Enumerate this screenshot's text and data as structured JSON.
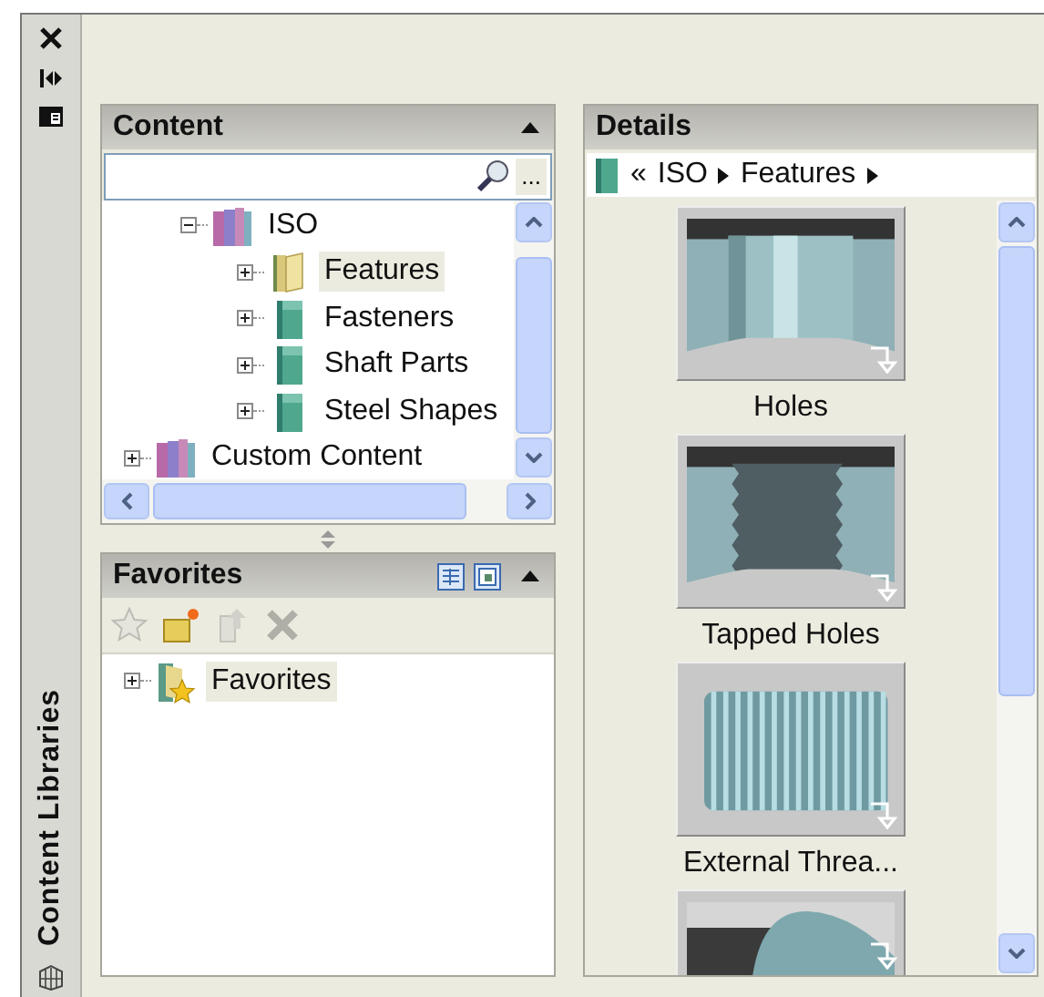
{
  "sidebar": {
    "title": "Content Libraries"
  },
  "content_panel": {
    "title": "Content",
    "search": {
      "browse_button": "..."
    },
    "tree": [
      {
        "children": [
          {
            "label": "ISO",
            "kind": "library",
            "expanded": true,
            "selected": false,
            "children": [
              {
                "label": "Features",
                "kind": "folder",
                "expanded": false,
                "selected": true
              },
              {
                "label": "Fasteners",
                "kind": "category",
                "expanded": false,
                "selected": false
              },
              {
                "label": "Shaft Parts",
                "kind": "category",
                "expanded": false,
                "selected": false
              },
              {
                "label": "Steel Shapes",
                "kind": "category",
                "expanded": false,
                "selected": false
              }
            ]
          }
        ]
      },
      {
        "label": "Custom Content",
        "kind": "library",
        "expanded": false,
        "selected": false
      }
    ]
  },
  "favorites_panel": {
    "title": "Favorites",
    "toolbar": [
      {
        "kind": "star",
        "disabled": true
      },
      {
        "kind": "new-folder",
        "disabled": false
      },
      {
        "kind": "move-up",
        "disabled": true
      },
      {
        "kind": "delete",
        "disabled": true
      }
    ],
    "tree": [
      {
        "label": "Favorites",
        "kind": "favorites",
        "expanded": false,
        "selected": true
      }
    ]
  },
  "details_panel": {
    "title": "Details",
    "breadcrumb": {
      "back": "«",
      "path": [
        "ISO",
        "Features"
      ]
    },
    "items": [
      {
        "label": "Holes",
        "kind": "hole"
      },
      {
        "label": "Tapped Holes",
        "kind": "tapped"
      },
      {
        "label": "External Threa...",
        "kind": "thread"
      },
      {
        "kind": "partial"
      }
    ]
  }
}
